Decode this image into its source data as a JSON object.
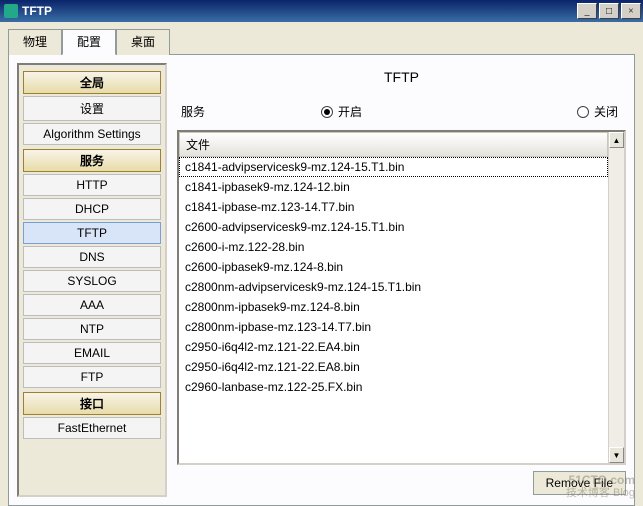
{
  "window": {
    "title": "TFTP"
  },
  "winbtns": {
    "min": "_",
    "max": "□",
    "close": "×"
  },
  "tabs": {
    "items": [
      "物理",
      "配置",
      "桌面"
    ],
    "active_index": 1
  },
  "sidebar": {
    "groups": [
      {
        "header": "全局",
        "items": [
          {
            "label": "设置",
            "selected": false
          },
          {
            "label": "Algorithm Settings",
            "selected": false
          }
        ]
      },
      {
        "header": "服务",
        "items": [
          {
            "label": "HTTP"
          },
          {
            "label": "DHCP"
          },
          {
            "label": "TFTP",
            "selected": true
          },
          {
            "label": "DNS"
          },
          {
            "label": "SYSLOG"
          },
          {
            "label": "AAA"
          },
          {
            "label": "NTP"
          },
          {
            "label": "EMAIL"
          },
          {
            "label": "FTP"
          }
        ]
      },
      {
        "header": "接口",
        "items": [
          {
            "label": "FastEthernet"
          }
        ]
      }
    ]
  },
  "content": {
    "heading": "TFTP",
    "service_label": "服务",
    "on_label": "开启",
    "off_label": "关闭",
    "on_checked": true,
    "files_header": "文件",
    "files": [
      "c1841-advipservicesk9-mz.124-15.T1.bin",
      "c1841-ipbasek9-mz.124-12.bin",
      "c1841-ipbase-mz.123-14.T7.bin",
      "c2600-advipservicesk9-mz.124-15.T1.bin",
      "c2600-i-mz.122-28.bin",
      "c2600-ipbasek9-mz.124-8.bin",
      "c2800nm-advipservicesk9-mz.124-15.T1.bin",
      "c2800nm-ipbasek9-mz.124-8.bin",
      "c2800nm-ipbase-mz.123-14.T7.bin",
      "c2950-i6q4l2-mz.121-22.EA4.bin",
      "c2950-i6q4l2-mz.121-22.EA8.bin",
      "c2960-lanbase-mz.122-25.FX.bin"
    ],
    "selected_file_index": 0,
    "remove_btn": "Remove File",
    "scroll_up": "▲",
    "scroll_down": "▼"
  },
  "watermark": {
    "main": "51CTO.com",
    "sub": "技术博客   Blog"
  }
}
